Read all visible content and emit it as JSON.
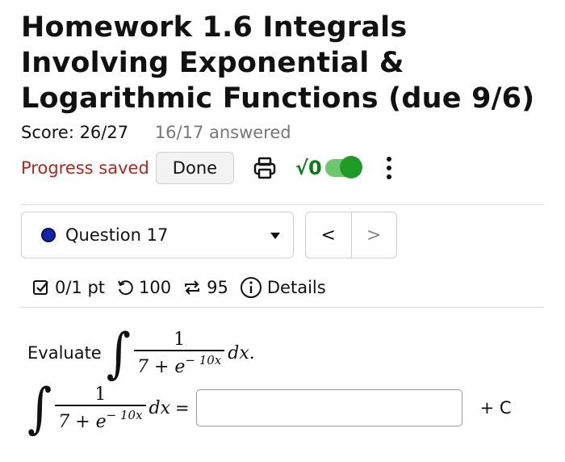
{
  "page": {
    "title": "Homework 1.6 Integrals Involving Exponential & Logarithmic Functions (due 9/6)"
  },
  "score": {
    "label": "Score: 26/27",
    "answered": "16/17 answered"
  },
  "toolbar": {
    "progress_label": "Progress saved",
    "done_label": "Done",
    "sqrt_label": "√0",
    "math_toggle_on": true,
    "icons": [
      "print-icon",
      "sqrt-toggle-icon",
      "more-options-icon"
    ]
  },
  "question_nav": {
    "selected": "Question 17",
    "status_color": "#1226a8",
    "prev": "<",
    "next": ">"
  },
  "meta": {
    "points": "0/1 pt",
    "retries": "100",
    "attempts": "95",
    "details": "Details"
  },
  "question": {
    "prompt": "Evaluate",
    "numerator": "1",
    "den_base": "7 + e",
    "den_exp": "− 10x",
    "differential": "dx.",
    "answer_differential": "dx",
    "equals": "=",
    "answer_value": "",
    "plus_c": "+ C"
  },
  "colors": {
    "progress": "#b3261e",
    "toggle": "#1f9a27",
    "accent_dot": "#1226a8"
  }
}
